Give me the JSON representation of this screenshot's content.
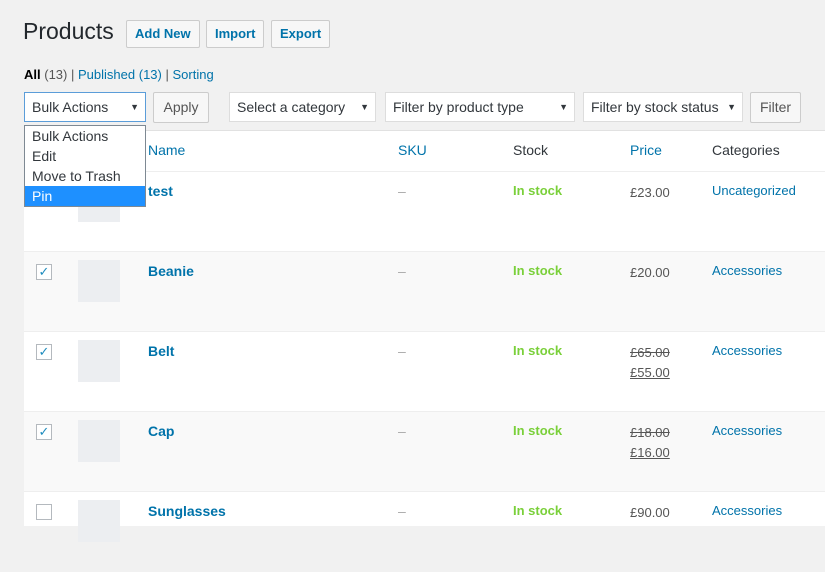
{
  "title": "Products",
  "page_buttons": [
    "Add New",
    "Import",
    "Export"
  ],
  "views": {
    "all": "All",
    "all_count": "(13)",
    "published": "Published",
    "published_count": "(13)",
    "sorting": "Sorting",
    "sep": "|"
  },
  "bulk": {
    "selected": "Bulk Actions",
    "options": [
      "Bulk Actions",
      "Edit",
      "Move to Trash",
      "Pin"
    ],
    "highlighted": "Pin",
    "apply": "Apply"
  },
  "filters": {
    "category": "Select a category",
    "type": "Filter by product type",
    "stock": "Filter by stock status",
    "button": "Filter"
  },
  "columns": {
    "name": "Name",
    "sku": "SKU",
    "stock": "Stock",
    "price": "Price",
    "categories": "Categories"
  },
  "rows": [
    {
      "name": "test",
      "sku": "–",
      "stock": "In stock",
      "price": "£23.00",
      "old_price": "",
      "category": "Uncategorized",
      "checked": false
    },
    {
      "name": "Beanie",
      "sku": "–",
      "stock": "In stock",
      "price": "£20.00",
      "old_price": "",
      "category": "Accessories",
      "checked": true
    },
    {
      "name": "Belt",
      "sku": "–",
      "stock": "In stock",
      "price": "£55.00",
      "old_price": "£65.00",
      "category": "Accessories",
      "checked": true
    },
    {
      "name": "Cap",
      "sku": "–",
      "stock": "In stock",
      "price": "£16.00",
      "old_price": "£18.00",
      "category": "Accessories",
      "checked": true
    },
    {
      "name": "Sunglasses",
      "sku": "–",
      "stock": "In stock",
      "price": "£90.00",
      "old_price": "",
      "category": "Accessories",
      "checked": false
    }
  ],
  "checkmark": "✓",
  "arrow": "▼"
}
